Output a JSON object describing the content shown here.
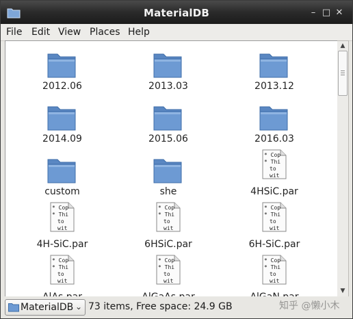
{
  "window": {
    "title": "MaterialDB"
  },
  "menubar": {
    "items": [
      "File",
      "Edit",
      "View",
      "Places",
      "Help"
    ]
  },
  "files": [
    {
      "name": "2012.06",
      "kind": "folder"
    },
    {
      "name": "2013.03",
      "kind": "folder"
    },
    {
      "name": "2013.12",
      "kind": "folder"
    },
    {
      "name": "2014.09",
      "kind": "folder"
    },
    {
      "name": "2015.06",
      "kind": "folder"
    },
    {
      "name": "2016.03",
      "kind": "folder"
    },
    {
      "name": "custom",
      "kind": "folder"
    },
    {
      "name": "she",
      "kind": "folder"
    },
    {
      "name": "4HSiC.par",
      "kind": "text-file"
    },
    {
      "name": "4H-SiC.par",
      "kind": "text-file"
    },
    {
      "name": "6HSiC.par",
      "kind": "text-file"
    },
    {
      "name": "6H-SiC.par",
      "kind": "text-file"
    },
    {
      "name": "AlAs.par",
      "kind": "text-file"
    },
    {
      "name": "AlGaAs.par",
      "kind": "text-file"
    },
    {
      "name": "AlGaN.par",
      "kind": "text-file"
    }
  ],
  "file_preview_lines": [
    "* Cop",
    "* Thi",
    "to",
    "wit"
  ],
  "statusbar": {
    "location": "MaterialDB",
    "info": "73 items, Free space: 24.9 GB"
  },
  "watermark": "知乎 @懒小木",
  "colors": {
    "folder": "#6d9ad3",
    "titlebar": "#2a2a2a"
  }
}
